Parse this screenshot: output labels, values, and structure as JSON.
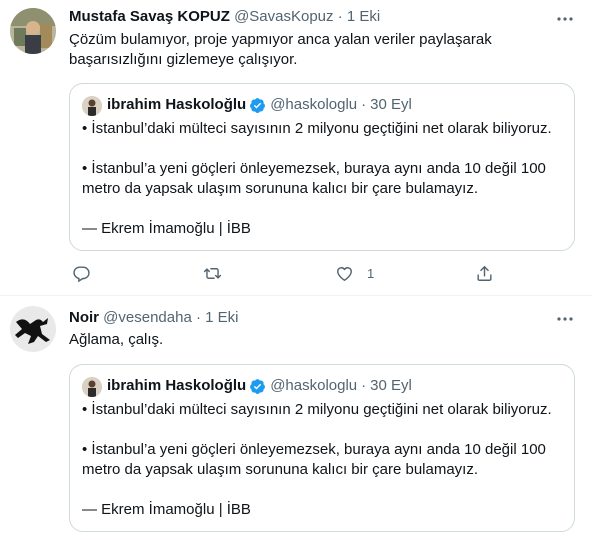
{
  "tweets": [
    {
      "author_name": "Mustafa Savaş KOPUZ",
      "handle": "@SavasKopuz",
      "separator": "·",
      "date": "1 Eki",
      "text": "Çözüm bulamıyor, proje yapmıyor anca yalan veriler paylaşarak başarısızlığını gizlemeye çalışıyor.",
      "quote": {
        "author_name": "ibrahim Haskoloğlu",
        "handle": "@haskologlu",
        "separator": "·",
        "date": "30 Eyl",
        "text": "• İstanbul’daki mülteci sayısının 2 milyonu geçtiğini net olarak biliyoruz.\n\n• İstanbul’a yeni göçleri önleyemezsek, buraya aynı anda 10 değil 100 metro da yapsak ulaşım sorununa kalıcı bir çare bulamayız.\n\n— Ekrem İmamoğlu | İBB"
      },
      "actions": {
        "reply_count": "",
        "retweet_count": "",
        "like_count": "1"
      }
    },
    {
      "author_name": "Noir",
      "handle": "@vesendaha",
      "separator": "·",
      "date": "1 Eki",
      "text": "Ağlama, çalış.",
      "quote": {
        "author_name": "ibrahim Haskoloğlu",
        "handle": "@haskologlu",
        "separator": "·",
        "date": "30 Eyl",
        "text": "• İstanbul’daki mülteci sayısının 2 milyonu geçtiğini net olarak biliyoruz.\n\n• İstanbul’a yeni göçleri önleyemezsek, buraya aynı anda 10 değil 100 metro da yapsak ulaşım sorununa kalıcı bir çare bulamayız.\n\n— Ekrem İmamoğlu | İBB"
      }
    }
  ],
  "icons": {
    "more": "more-icon",
    "verified": "verified-badge-icon",
    "reply": "reply-icon",
    "retweet": "retweet-icon",
    "like": "like-icon",
    "share": "share-icon"
  },
  "colors": {
    "text": "#0f1419",
    "secondary": "#536471",
    "border": "#cfd9de",
    "verified": "#1d9bf0"
  }
}
